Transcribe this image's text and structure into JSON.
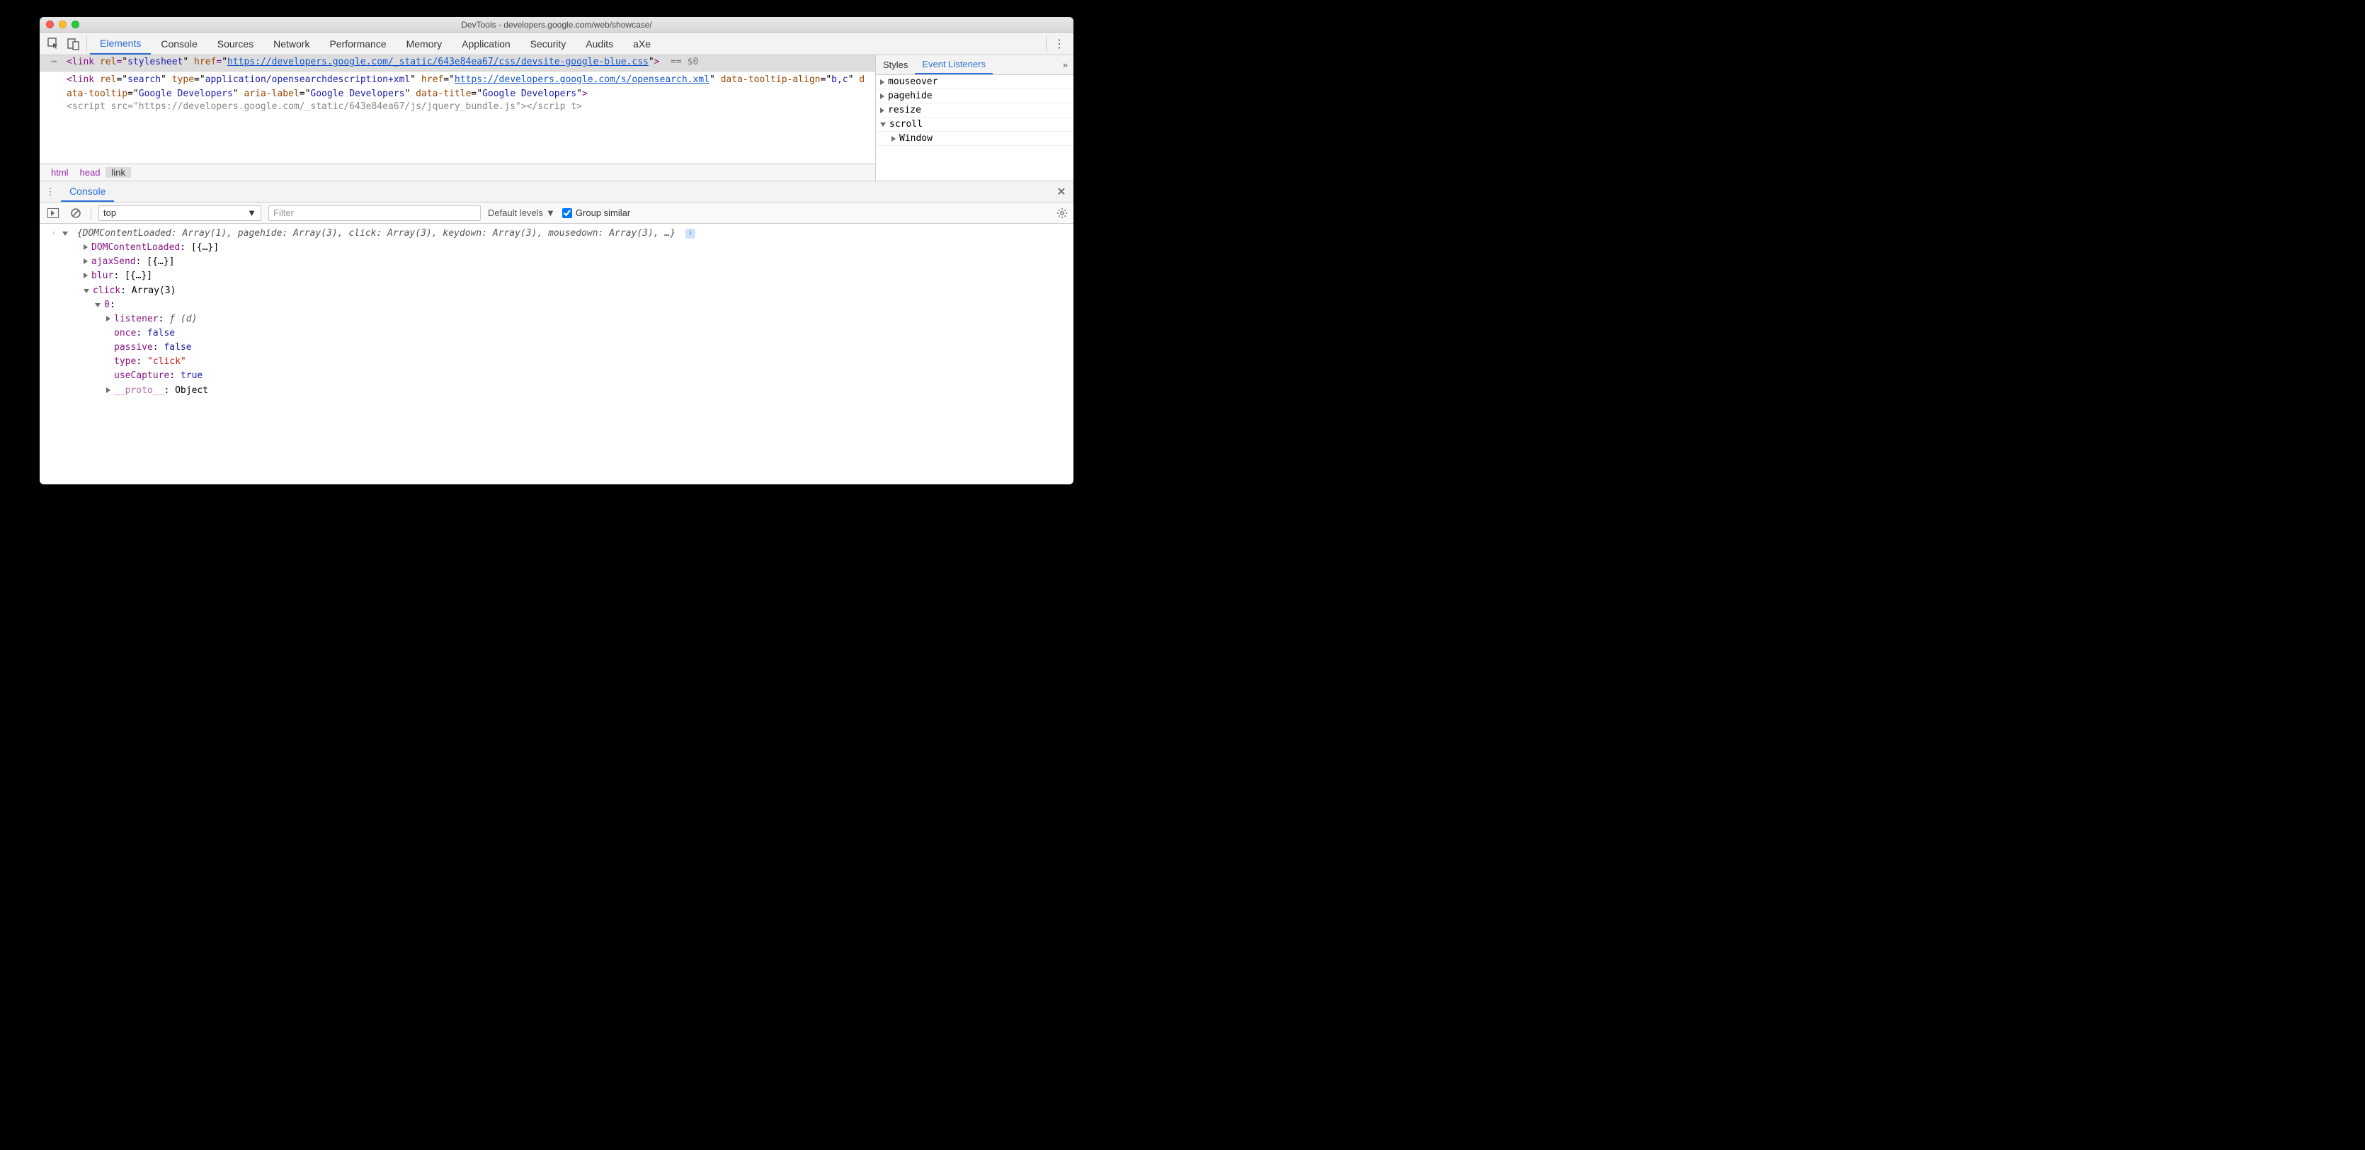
{
  "window": {
    "title": "DevTools - developers.google.com/web/showcase/"
  },
  "tabs": {
    "items": [
      "Elements",
      "Console",
      "Sources",
      "Network",
      "Performance",
      "Memory",
      "Application",
      "Security",
      "Audits",
      "aXe"
    ],
    "active": "Elements"
  },
  "dom": {
    "selected_prefix": "<link ",
    "selected_rel_attr": "rel",
    "selected_rel_val": "stylesheet",
    "selected_href_attr": "href",
    "selected_href_url": "https://developers.google.com/_static/643e84ea67/css/devsite-google-blue.css",
    "eq0": "== $0",
    "row2_text_pre": "<link ",
    "row2_rel": "search",
    "row2_type_attr": "type",
    "row2_type_val": "application/opensearchdescription+xml",
    "row2_href_attr": "href",
    "row2_href_url": "https://developers.google.com/s/opensearch.xml",
    "row2_tt_align_attr": "data-tooltip-align",
    "row2_tt_align_val": "b,c",
    "row2_tt_attr": "data-tooltip",
    "row2_tt_val": "Google Developers",
    "row2_aria_attr": "aria-label",
    "row2_aria_val": "Google Developers",
    "row2_dt_attr": "data-title",
    "row2_dt_val": "Google Developers",
    "row3_cut": "<script src=\"https://developers.google.com/_static/643e84ea67/js/jquery_bundle.js\"></scrip t>"
  },
  "breadcrumb": {
    "items": [
      "html",
      "head",
      "link"
    ],
    "current": "link"
  },
  "sidebar": {
    "tabs": [
      "Styles",
      "Event Listeners"
    ],
    "active": "Event Listeners",
    "listeners": {
      "items": [
        "mouseover",
        "pagehide",
        "resize",
        "scroll"
      ],
      "expanded": "scroll",
      "scroll_child": "Window"
    }
  },
  "drawer": {
    "tab": "Console",
    "context": "top",
    "filter_placeholder": "Filter",
    "levels_label": "Default levels",
    "group_similar": "Group similar"
  },
  "console": {
    "summary_raw": "{DOMContentLoaded: Array(1), pagehide: Array(3), click: Array(3), keydown: Array(3), mousedown: Array(3), …}",
    "entries": {
      "dcl_key": "DOMContentLoaded",
      "dcl_val": "[{…}]",
      "ajax_key": "ajaxSend",
      "ajax_val": "[{…}]",
      "blur_key": "blur",
      "blur_val": "[{…}]",
      "click_key": "click",
      "click_val": "Array(3)",
      "click0_idx": "0",
      "listener_key": "listener",
      "listener_val": "ƒ (d)",
      "once_key": "once",
      "once_val": "false",
      "passive_key": "passive",
      "passive_val": "false",
      "type_key": "type",
      "type_val": "\"click\"",
      "useCapture_key": "useCapture",
      "useCapture_val": "true",
      "proto_key": "__proto__",
      "proto_val": "Object"
    }
  }
}
